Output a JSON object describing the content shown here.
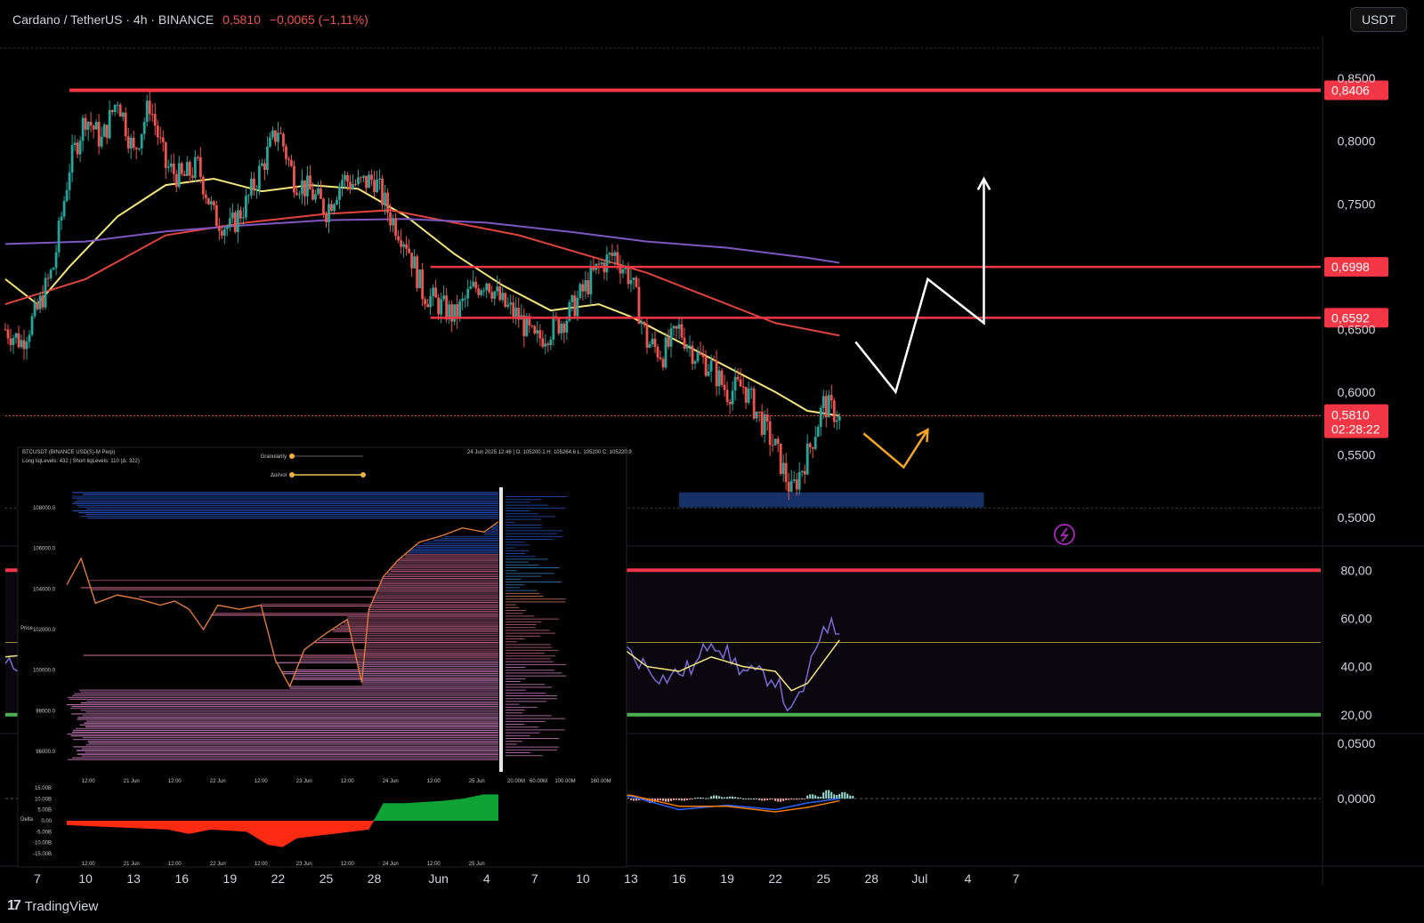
{
  "header": {
    "symbol": "Cardano / TetherUS · 4h · BINANCE",
    "price": "0,5810",
    "change": "−0,0065 (−1,11%)"
  },
  "currency_label": "USDT",
  "footer": {
    "logo": "17",
    "brand": "TradingView"
  },
  "colors": {
    "up": "#26a69a",
    "down": "#ef5350",
    "level": "#f23645",
    "ma_fast": "#f5e67a",
    "ma_slow": "#e0443c",
    "ma_long": "#7e57c2",
    "rsi": "#7e6ad6",
    "rsi_ma": "#f5e67a",
    "zone": "#1a3a7a"
  },
  "chart_data": [
    {
      "type": "candlestick",
      "symbol": "Cardano / TetherUS",
      "interval": "4h",
      "exchange": "BINANCE",
      "last_price": 0.581,
      "countdown": "02:28:22",
      "ylim": [
        0.49,
        0.87
      ],
      "y_ticks": [
        "0,8500",
        "0,8000",
        "0,7500",
        "0,6500",
        "0,6000",
        "0,5500",
        "0,5000"
      ],
      "y_tick_values": [
        0.85,
        0.8,
        0.75,
        0.65,
        0.6,
        0.55,
        0.5
      ],
      "x_tick_labels": [
        "7",
        "10",
        "13",
        "16",
        "19",
        "22",
        "25",
        "28",
        "Jun",
        "4",
        "7",
        "10",
        "13",
        "16",
        "19",
        "22",
        "25",
        "28",
        "Jul",
        "4",
        "7"
      ],
      "x_range_days": [
        5,
        87
      ],
      "x_tick_days": [
        7,
        10,
        13,
        16,
        19,
        22,
        25,
        28,
        32,
        35,
        38,
        41,
        44,
        47,
        50,
        53,
        56,
        59,
        62,
        65,
        68
      ],
      "price_path": [
        [
          5,
          0.65
        ],
        [
          6,
          0.64
        ],
        [
          7,
          0.665
        ],
        [
          8,
          0.7
        ],
        [
          9,
          0.78
        ],
        [
          10,
          0.82
        ],
        [
          11,
          0.8
        ],
        [
          12,
          0.835
        ],
        [
          13,
          0.79
        ],
        [
          14,
          0.83
        ],
        [
          15,
          0.78
        ],
        [
          16,
          0.77
        ],
        [
          17,
          0.78
        ],
        [
          18,
          0.74
        ],
        [
          19,
          0.73
        ],
        [
          20,
          0.75
        ],
        [
          21,
          0.78
        ],
        [
          22,
          0.81
        ],
        [
          23,
          0.77
        ],
        [
          24,
          0.76
        ],
        [
          25,
          0.745
        ],
        [
          26,
          0.77
        ],
        [
          27,
          0.765
        ],
        [
          28,
          0.77
        ],
        [
          29,
          0.74
        ],
        [
          30,
          0.72
        ],
        [
          31,
          0.68
        ],
        [
          32,
          0.67
        ],
        [
          33,
          0.66
        ],
        [
          34,
          0.68
        ],
        [
          35,
          0.69
        ],
        [
          36,
          0.67
        ],
        [
          37,
          0.66
        ],
        [
          38,
          0.64
        ],
        [
          39,
          0.65
        ],
        [
          40,
          0.66
        ],
        [
          41,
          0.68
        ],
        [
          42,
          0.7
        ],
        [
          43,
          0.71
        ],
        [
          44,
          0.69
        ],
        [
          45,
          0.64
        ],
        [
          46,
          0.63
        ],
        [
          47,
          0.65
        ],
        [
          48,
          0.63
        ],
        [
          49,
          0.62
        ],
        [
          50,
          0.6
        ],
        [
          51,
          0.605
        ],
        [
          52,
          0.58
        ],
        [
          53,
          0.555
        ],
        [
          54,
          0.52
        ],
        [
          55,
          0.55
        ],
        [
          56,
          0.59
        ],
        [
          57,
          0.581
        ]
      ],
      "lines": [
        {
          "name": "",
          "color": "#f5e67a",
          "points": [
            [
              5,
              0.69
            ],
            [
              7,
              0.67
            ],
            [
              9,
              0.7
            ],
            [
              12,
              0.74
            ],
            [
              15,
              0.765
            ],
            [
              18,
              0.77
            ],
            [
              21,
              0.76
            ],
            [
              24,
              0.765
            ],
            [
              27,
              0.762
            ],
            [
              30,
              0.74
            ],
            [
              33,
              0.71
            ],
            [
              36,
              0.685
            ],
            [
              39,
              0.665
            ],
            [
              42,
              0.67
            ],
            [
              44,
              0.66
            ],
            [
              47,
              0.64
            ],
            [
              50,
              0.62
            ],
            [
              53,
              0.6
            ],
            [
              55,
              0.585
            ],
            [
              57,
              0.581
            ]
          ]
        },
        {
          "name": "",
          "color": "#e0443c",
          "points": [
            [
              5,
              0.67
            ],
            [
              10,
              0.69
            ],
            [
              15,
              0.725
            ],
            [
              20,
              0.735
            ],
            [
              25,
              0.742
            ],
            [
              29,
              0.745
            ],
            [
              33,
              0.735
            ],
            [
              37,
              0.725
            ],
            [
              41,
              0.71
            ],
            [
              45,
              0.695
            ],
            [
              49,
              0.675
            ],
            [
              53,
              0.655
            ],
            [
              57,
              0.645
            ]
          ]
        },
        {
          "name": "",
          "color": "#7e57c2",
          "points": [
            [
              5,
              0.718
            ],
            [
              10,
              0.72
            ],
            [
              15,
              0.728
            ],
            [
              20,
              0.733
            ],
            [
              25,
              0.737
            ],
            [
              30,
              0.738
            ],
            [
              35,
              0.735
            ],
            [
              40,
              0.728
            ],
            [
              45,
              0.72
            ],
            [
              50,
              0.715
            ],
            [
              55,
              0.707
            ],
            [
              57,
              0.703
            ]
          ]
        }
      ],
      "horizontal_levels": [
        {
          "value": 0.8406,
          "label": "0,8406",
          "x_start_day": 9
        },
        {
          "value": 0.6998,
          "label": "0,6998",
          "x_start_day": 31.5
        },
        {
          "value": 0.6592,
          "label": "0,6592",
          "x_start_day": 31.5
        }
      ],
      "demand_zone": {
        "x_from_day": 47,
        "x_to_day": 66,
        "y_from": 0.508,
        "y_to": 0.52
      },
      "projections": [
        {
          "color": "#ffffff",
          "points": [
            [
              58,
              0.64
            ],
            [
              60.5,
              0.6
            ],
            [
              62.5,
              0.69
            ],
            [
              66,
              0.655
            ],
            [
              66,
              0.77
            ]
          ]
        },
        {
          "color": "#f5a623",
          "points": [
            [
              58.5,
              0.567
            ],
            [
              61,
              0.54
            ],
            [
              62.5,
              0.57
            ]
          ]
        }
      ]
    },
    {
      "type": "line",
      "indicator": "RSI",
      "ylim": [
        14,
        86
      ],
      "y_ticks": [
        "80,00",
        "60,00",
        "40,00",
        "20,00"
      ],
      "y_tick_values": [
        80,
        60,
        40,
        20
      ],
      "bands": [
        {
          "value": 80,
          "color": "#f23645"
        },
        {
          "value": 50,
          "color": "#a08a3c"
        },
        {
          "value": 20,
          "color": "#4caf50"
        }
      ],
      "series": [
        {
          "name": "",
          "color": "#7e6ad6",
          "points": [
            [
              5,
              40
            ],
            [
              8,
              45
            ],
            [
              11,
              55
            ],
            [
              14,
              48
            ],
            [
              17,
              42
            ],
            [
              20,
              46
            ],
            [
              23,
              50
            ],
            [
              26,
              48
            ],
            [
              29,
              42
            ],
            [
              32,
              35
            ],
            [
              35,
              40
            ],
            [
              37,
              38
            ],
            [
              39,
              45
            ],
            [
              41,
              62
            ],
            [
              42,
              56
            ],
            [
              44,
              45
            ],
            [
              46,
              35
            ],
            [
              48,
              40
            ],
            [
              49,
              52
            ],
            [
              51,
              38
            ],
            [
              53,
              35
            ],
            [
              54,
              20
            ],
            [
              55,
              35
            ],
            [
              56,
              58
            ],
            [
              57,
              55
            ]
          ]
        },
        {
          "name": "",
          "color": "#f5e67a",
          "points": [
            [
              5,
              44
            ],
            [
              8,
              46
            ],
            [
              11,
              50
            ],
            [
              14,
              47
            ],
            [
              17,
              45
            ],
            [
              20,
              47
            ],
            [
              23,
              48
            ],
            [
              26,
              47
            ],
            [
              29,
              44
            ],
            [
              32,
              40
            ],
            [
              35,
              40
            ],
            [
              38,
              42
            ],
            [
              41,
              56
            ],
            [
              43,
              50
            ],
            [
              45,
              40
            ],
            [
              47,
              38
            ],
            [
              49,
              44
            ],
            [
              51,
              40
            ],
            [
              53,
              38
            ],
            [
              54,
              30
            ],
            [
              55,
              33
            ],
            [
              57,
              51
            ]
          ]
        }
      ]
    },
    {
      "type": "bar",
      "indicator": "MACD",
      "ylim": [
        -0.05,
        0.055
      ],
      "y_ticks": [
        "0,0500",
        "0,0000"
      ],
      "y_tick_values": [
        0.05,
        0.0
      ],
      "histogram": [
        [
          38,
          0.002
        ],
        [
          39,
          0.003
        ],
        [
          40,
          0.004
        ],
        [
          41,
          0.005
        ],
        [
          42,
          0.004
        ],
        [
          43,
          0.002
        ],
        [
          44,
          -0.002
        ],
        [
          45,
          -0.004
        ],
        [
          46,
          -0.003
        ],
        [
          47,
          -0.002
        ],
        [
          48,
          0.001
        ],
        [
          49,
          0.003
        ],
        [
          50,
          0.002
        ],
        [
          51,
          0.0
        ],
        [
          52,
          -0.002
        ],
        [
          53,
          -0.003
        ],
        [
          54,
          -0.001
        ],
        [
          55,
          0.004
        ],
        [
          56,
          0.008
        ],
        [
          57,
          0.006
        ]
      ],
      "series": [
        {
          "name": "",
          "color": "#2962ff",
          "points": [
            [
              38,
              -0.002
            ],
            [
              41,
              0.006
            ],
            [
              44,
              0.002
            ],
            [
              47,
              -0.01
            ],
            [
              50,
              -0.006
            ],
            [
              53,
              -0.01
            ],
            [
              55,
              -0.004
            ],
            [
              57,
              0.0
            ]
          ]
        },
        {
          "name": "",
          "color": "#f57c00",
          "points": [
            [
              38,
              -0.001
            ],
            [
              41,
              0.004
            ],
            [
              44,
              0.003
            ],
            [
              47,
              -0.007
            ],
            [
              50,
              -0.007
            ],
            [
              53,
              -0.012
            ],
            [
              55,
              -0.008
            ],
            [
              57,
              -0.002
            ]
          ]
        }
      ]
    },
    {
      "type": "heatmap",
      "title": "BTCUSDT (BINANCE USD(S)-M Perp)",
      "subtitle": "Long liqLevels: 432 | Short liqLevels: 110 (Δ: 322)",
      "ohlc": "24 Jun 2025 12:46 | O: 105200.1 H: 105264.6 L: 105200 C: 105220.9",
      "controls": [
        "Granularity",
        "Δoi/vol"
      ],
      "ylabel": "Price",
      "y_ticks": [
        "108000.0",
        "106000.0",
        "104000.0",
        "102000.0",
        "100000.0",
        "98000.0",
        "96000.0"
      ],
      "y_tick_values": [
        108000,
        106000,
        104000,
        102000,
        100000,
        98000,
        96000
      ],
      "ylim": [
        95000,
        109000
      ],
      "x_ticks": [
        "12:00",
        "21 Jun",
        "12:00",
        "22 Jun",
        "12:00",
        "23 Jun",
        "12:00",
        "24 Jun",
        "12:00",
        "25 Jun"
      ],
      "x_tick_hours": [
        12,
        24,
        36,
        48,
        60,
        72,
        84,
        96,
        108,
        120
      ],
      "xlim_hours": [
        6,
        126
      ],
      "volume_ticks": [
        "20.00M",
        "60.00M",
        "100.00M",
        "160.00M"
      ],
      "price_path": [
        [
          6,
          104200
        ],
        [
          10,
          105500
        ],
        [
          14,
          103300
        ],
        [
          20,
          103700
        ],
        [
          26,
          103500
        ],
        [
          32,
          103200
        ],
        [
          36,
          103400
        ],
        [
          40,
          103000
        ],
        [
          44,
          102000
        ],
        [
          48,
          103200
        ],
        [
          54,
          103000
        ],
        [
          60,
          103200
        ],
        [
          64,
          100500
        ],
        [
          68,
          99200
        ],
        [
          72,
          101000
        ],
        [
          78,
          101800
        ],
        [
          84,
          102500
        ],
        [
          88,
          99400
        ],
        [
          90,
          103000
        ],
        [
          94,
          104600
        ],
        [
          98,
          105400
        ],
        [
          104,
          106300
        ],
        [
          110,
          106600
        ],
        [
          116,
          107000
        ],
        [
          122,
          106800
        ],
        [
          126,
          107300
        ]
      ],
      "delta_ylabel": "Delta",
      "delta_ticks": [
        "15.00B",
        "10.00B",
        "5.00B",
        "0.00",
        "-5.00B",
        "-10.00B",
        "-15.00B"
      ],
      "delta_tick_values": [
        15,
        10,
        5,
        0,
        -5,
        -10,
        -15
      ],
      "delta_ylim": [
        -17,
        17
      ],
      "delta_path": [
        [
          6,
          -2
        ],
        [
          20,
          -3
        ],
        [
          34,
          -4
        ],
        [
          40,
          -6
        ],
        [
          46,
          -4
        ],
        [
          56,
          -5
        ],
        [
          62,
          -11
        ],
        [
          66,
          -12
        ],
        [
          70,
          -8
        ],
        [
          80,
          -6
        ],
        [
          90,
          -4
        ],
        [
          94,
          8
        ],
        [
          100,
          8
        ],
        [
          110,
          9
        ],
        [
          116,
          10
        ],
        [
          122,
          12
        ],
        [
          126,
          12
        ]
      ]
    }
  ]
}
